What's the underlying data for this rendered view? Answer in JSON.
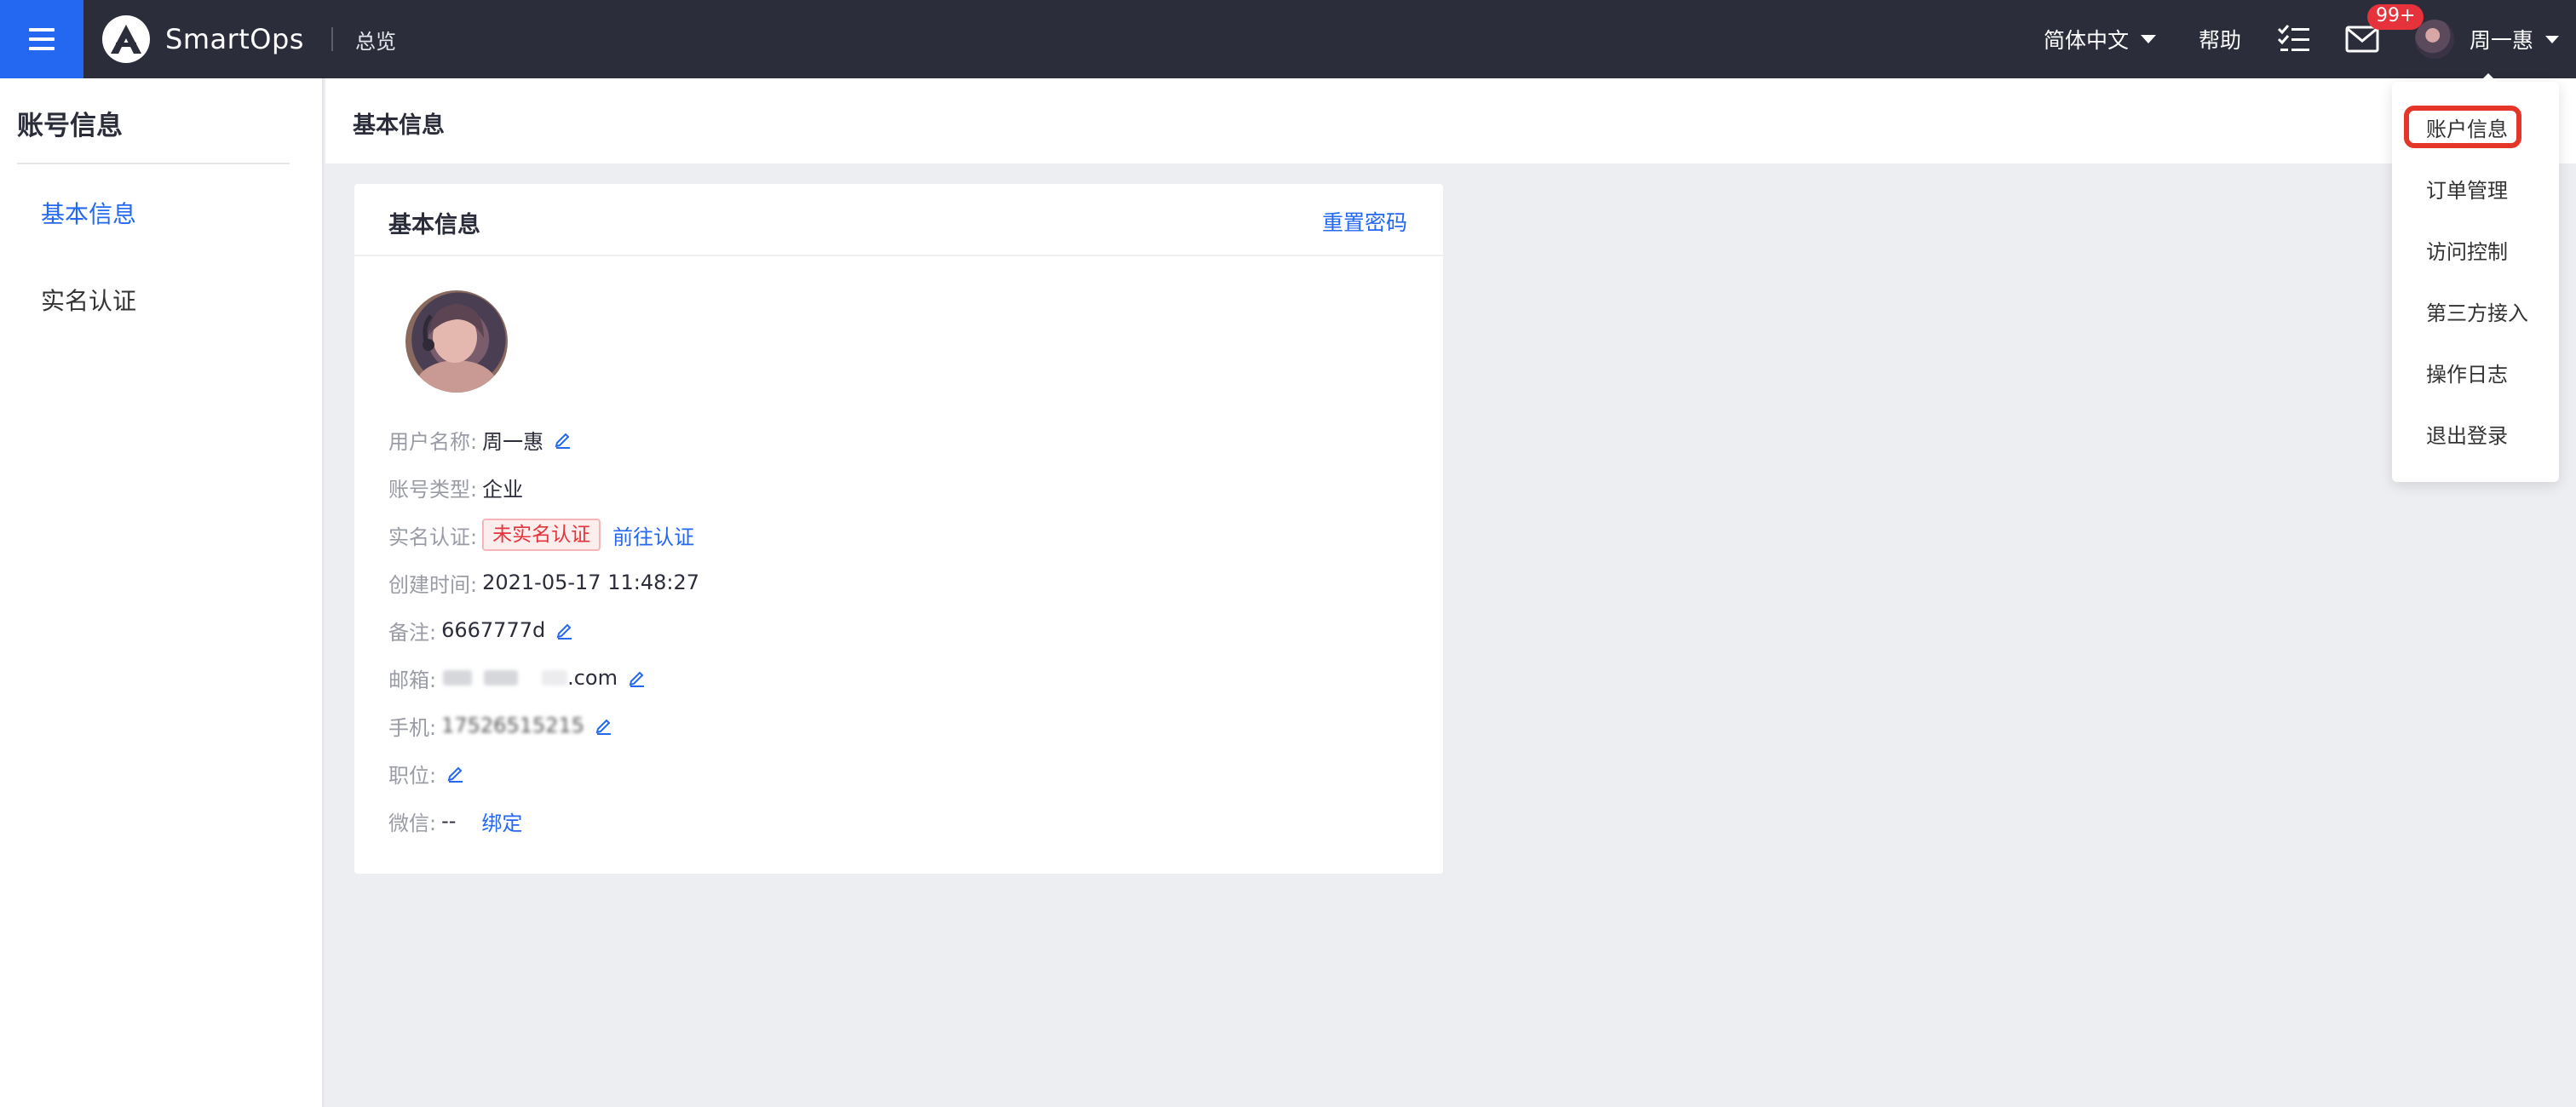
{
  "topbar": {
    "app_name": "SmartOps",
    "nav_overview": "总览",
    "language": "简体中文",
    "help": "帮助",
    "mail_badge": "99+",
    "username": "周一惠"
  },
  "sidebar": {
    "title": "账号信息",
    "items": [
      {
        "label": "基本信息",
        "active": true
      },
      {
        "label": "实名认证",
        "active": false
      }
    ]
  },
  "content": {
    "page_title": "基本信息",
    "card": {
      "title": "基本信息",
      "reset_password": "重置密码",
      "fields": {
        "username_label": "用户名称:",
        "username_value": "周一惠",
        "account_type_label": "账号类型:",
        "account_type_value": "企业",
        "verify_label": "实名认证:",
        "verify_status": "未实名认证",
        "verify_action": "前往认证",
        "created_label": "创建时间:",
        "created_value": "2021-05-17 11:48:27",
        "remark_label": "备注:",
        "remark_value": "6667777d",
        "email_label": "邮箱:",
        "email_value_suffix": ".com",
        "phone_label": "手机:",
        "phone_value": "17526515215",
        "position_label": "职位:",
        "wechat_label": "微信:",
        "wechat_value": "--",
        "wechat_action": "绑定"
      }
    }
  },
  "dropdown": {
    "items": [
      "账户信息",
      "订单管理",
      "访问控制",
      "第三方接入",
      "操作日志",
      "退出登录"
    ],
    "highlighted": "账户信息"
  },
  "colors": {
    "topbar_bg": "#2b2d3b",
    "accent": "#2468f2",
    "danger": "#e5323b",
    "highlight_outline": "#e53428"
  }
}
